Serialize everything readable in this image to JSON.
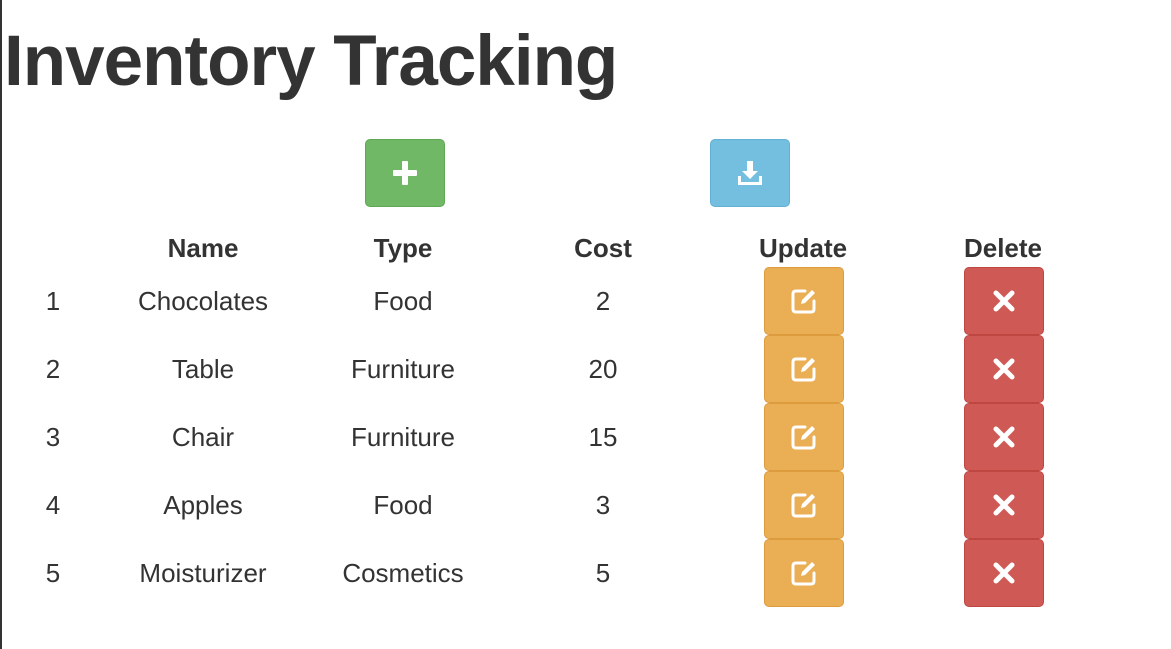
{
  "title": "Inventory Tracking",
  "toolbar": {
    "add_icon": "plus-icon",
    "download_icon": "download-icon"
  },
  "columns": [
    "",
    "Name",
    "Type",
    "Cost",
    "Update",
    "Delete"
  ],
  "rows": [
    {
      "index": "1",
      "name": "Chocolates",
      "type": "Food",
      "cost": "2"
    },
    {
      "index": "2",
      "name": "Table",
      "type": "Furniture",
      "cost": "20"
    },
    {
      "index": "3",
      "name": "Chair",
      "type": "Furniture",
      "cost": "15"
    },
    {
      "index": "4",
      "name": "Apples",
      "type": "Food",
      "cost": "3"
    },
    {
      "index": "5",
      "name": "Moisturizer",
      "type": "Cosmetics",
      "cost": "5"
    }
  ],
  "row_actions": {
    "update_icon": "edit-icon",
    "delete_icon": "close-icon"
  },
  "colors": {
    "add": "#70b865",
    "download": "#74bfe0",
    "update": "#eaae55",
    "delete": "#cf5a55",
    "text": "#333333"
  }
}
